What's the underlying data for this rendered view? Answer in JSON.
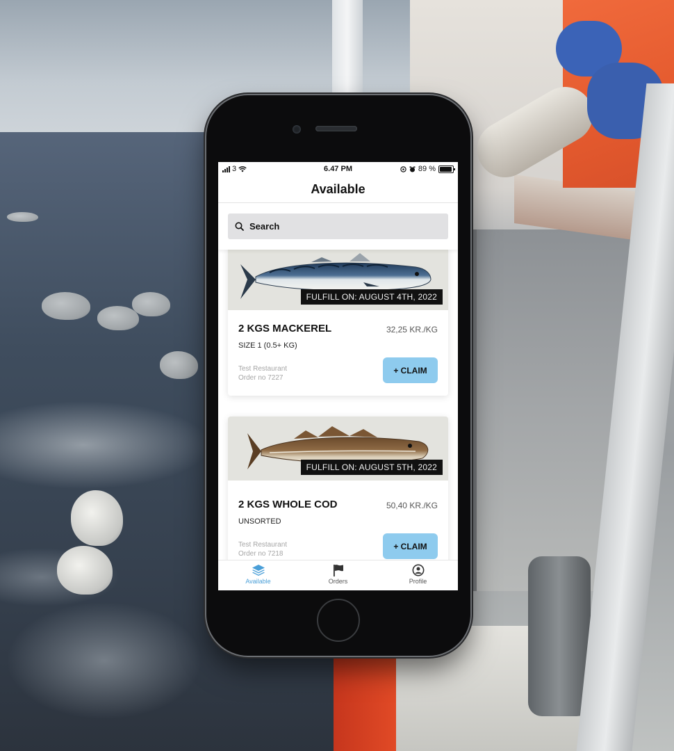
{
  "status_bar": {
    "carrier": "3",
    "time": "6.47 PM",
    "battery_percent": "89 %"
  },
  "header": {
    "title": "Available"
  },
  "search": {
    "placeholder": "Search",
    "icon": "magnifier-icon"
  },
  "orders": [
    {
      "fulfill": "FULFILL ON: AUGUST 4TH, 2022",
      "title": "2 KGS MACKEREL",
      "price": "32,25 KR./KG",
      "size": "SIZE 1 (0.5+ KG)",
      "restaurant": "Test Restaurant",
      "order_no": "Order no 7227",
      "claim_label": "+ CLAIM"
    },
    {
      "fulfill": "FULFILL ON: AUGUST 5TH, 2022",
      "title": "2 KGS WHOLE COD",
      "price": "50,40 KR./KG",
      "size": "UNSORTED",
      "restaurant": "Test Restaurant",
      "order_no": "Order no 7218",
      "claim_label": "+ CLAIM"
    }
  ],
  "tabbar": {
    "items": [
      {
        "label": "Available",
        "icon": "layers-icon",
        "active": true
      },
      {
        "label": "Orders",
        "icon": "flag-icon",
        "active": false
      },
      {
        "label": "Profile",
        "icon": "user-circle-icon",
        "active": false
      }
    ]
  },
  "colors": {
    "accent": "#4a9fd8",
    "claim_button": "#8ecbee",
    "fulfill_badge": "#111111"
  }
}
